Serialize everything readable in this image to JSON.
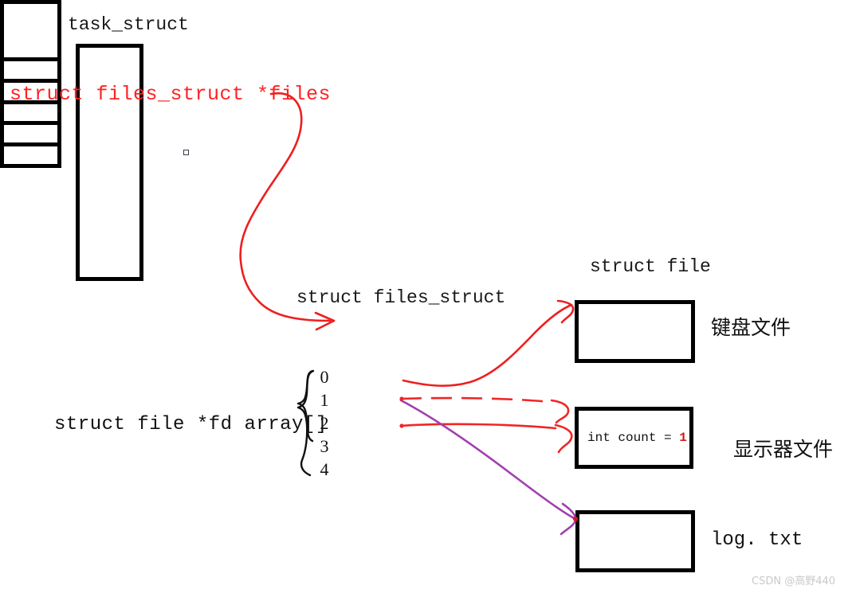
{
  "diagram": {
    "title_task_struct": "task_struct",
    "title_files_struct": "struct files_struct",
    "title_struct_file": "struct file",
    "files_pointer_label": "struct files_struct *files",
    "fd_array_label": "struct file *fd array[]",
    "fd_indices": [
      "0",
      "1",
      "2",
      "3",
      "4"
    ],
    "files": {
      "keyboard": {
        "label": "键盘文件",
        "content": ""
      },
      "monitor": {
        "label": "显示器文件",
        "count_prefix": "int count = ",
        "count_value": "1"
      },
      "log": {
        "label": "log. txt",
        "content": ""
      }
    },
    "colors": {
      "pointer_red": "#ff2222",
      "arrow_red": "#ee1f1f",
      "arrow_purple": "#a martin"
    }
  },
  "watermark": "CSDN @高野440"
}
